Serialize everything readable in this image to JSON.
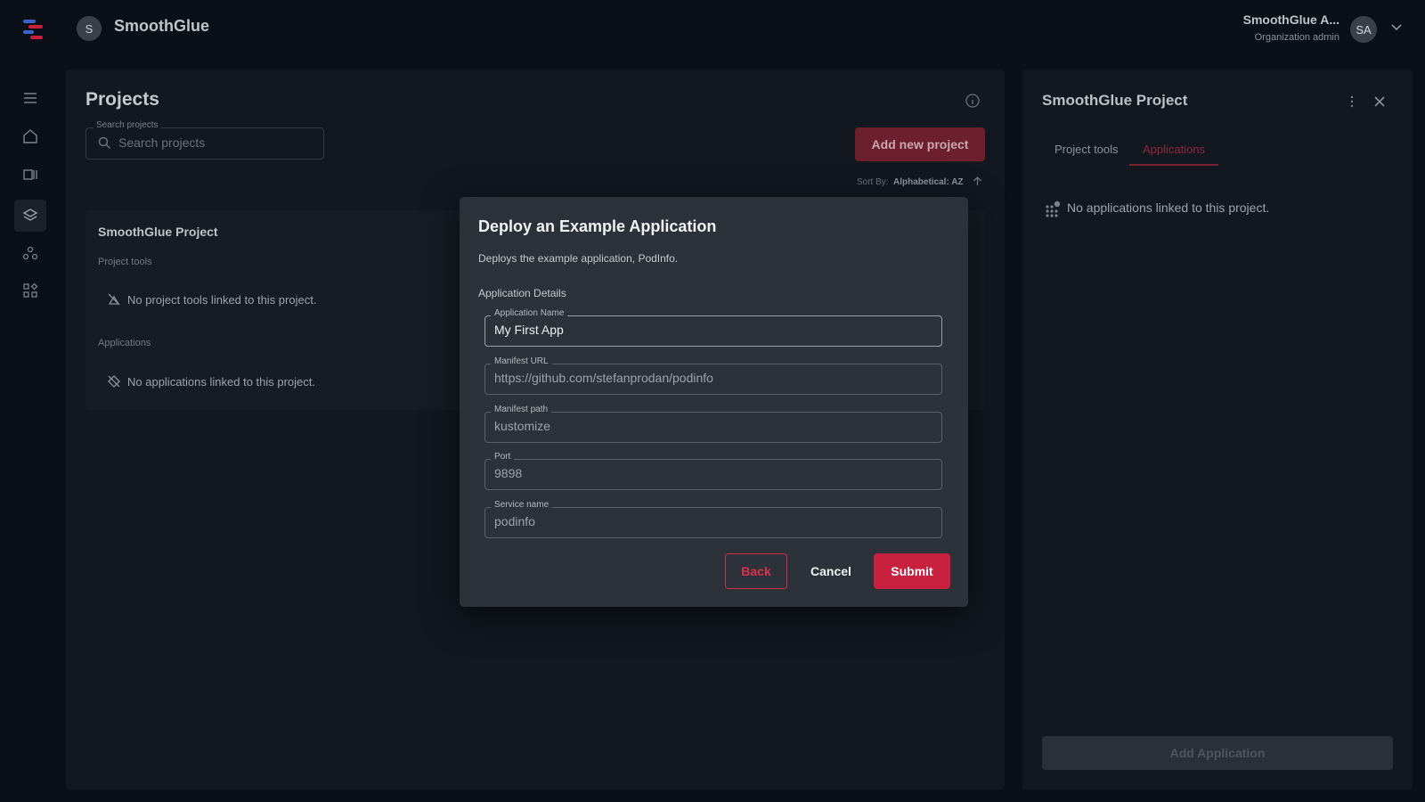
{
  "header": {
    "org_initial": "S",
    "org_name": "SmoothGlue",
    "user_name": "SmoothGlue A...",
    "user_role": "Organization admin",
    "user_initials": "SA"
  },
  "sidebar": {
    "items": [
      {
        "icon": "menu-icon"
      },
      {
        "icon": "home-icon"
      },
      {
        "icon": "catalog-icon"
      },
      {
        "icon": "layers-icon",
        "active": true
      },
      {
        "icon": "teams-icon"
      },
      {
        "icon": "apps-grid-icon"
      }
    ]
  },
  "projects": {
    "title": "Projects",
    "search": {
      "legend": "Search projects",
      "placeholder": "Search projects"
    },
    "add_button": "Add new project",
    "sort_label": "Sort By:",
    "sort_value": "Alphabetical: AZ",
    "card": {
      "title": "SmoothGlue Project",
      "tools_label": "Project tools",
      "tools_empty": "No project tools linked to this project.",
      "apps_label": "Applications",
      "apps_empty": "No applications linked to this project."
    }
  },
  "detail_panel": {
    "title": "SmoothGlue Project",
    "tabs": [
      "Project tools",
      "Applications"
    ],
    "active_tab": "Applications",
    "empty_text": "No applications linked to this project.",
    "add_button": "Add Application"
  },
  "dialog": {
    "title": "Deploy an Example Application",
    "description": "Deploys the example application, PodInfo.",
    "section": "Application Details",
    "fields": [
      {
        "label": "Application Name",
        "value": "My First App"
      },
      {
        "label": "Manifest URL",
        "value": "https://github.com/stefanprodan/podinfo"
      },
      {
        "label": "Manifest path",
        "value": "kustomize"
      },
      {
        "label": "Port",
        "value": "9898"
      },
      {
        "label": "Service name",
        "value": "podinfo"
      }
    ],
    "back_label": "Back",
    "cancel_label": "Cancel",
    "submit_label": "Submit"
  },
  "colors": {
    "background": "#0b0f17",
    "dialog": "#2d323a",
    "accent": "#c8203f"
  }
}
